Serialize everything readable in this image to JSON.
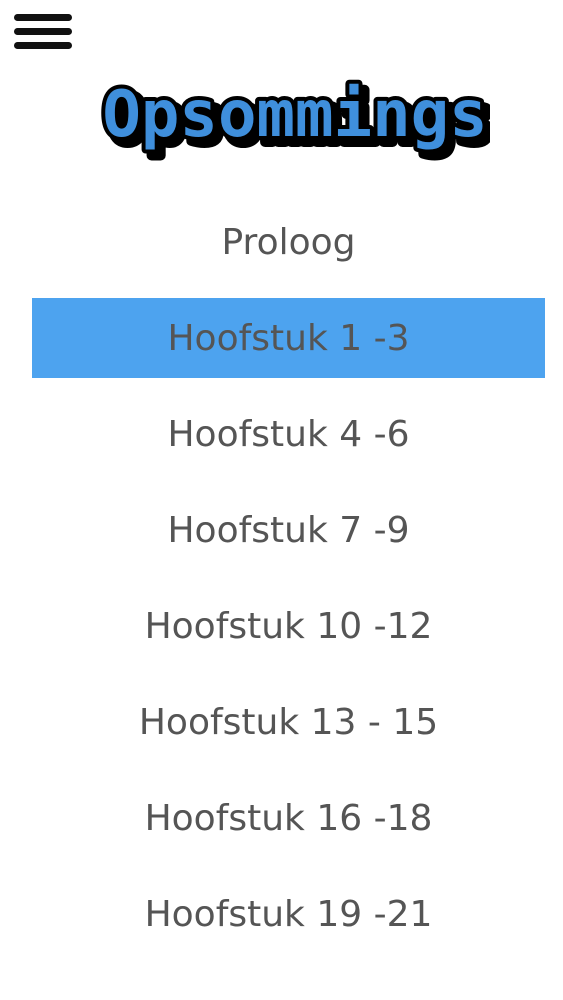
{
  "header": {
    "menu_icon": "hamburger-menu-icon",
    "logo_text": "Opsommings",
    "logo_fill_color": "#3f8fdc",
    "logo_shadow_color": "#000000"
  },
  "chapters": {
    "selected_index": 1,
    "selected_color": "#4da3ef",
    "items": [
      {
        "label": "Proloog"
      },
      {
        "label": "Hoofstuk 1 -3"
      },
      {
        "label": "Hoofstuk 4 -6"
      },
      {
        "label": "Hoofstuk 7 -9"
      },
      {
        "label": "Hoofstuk 10 -12"
      },
      {
        "label": "Hoofstuk 13 - 15"
      },
      {
        "label": "Hoofstuk 16 -18"
      },
      {
        "label": "Hoofstuk 19 -21"
      }
    ]
  }
}
